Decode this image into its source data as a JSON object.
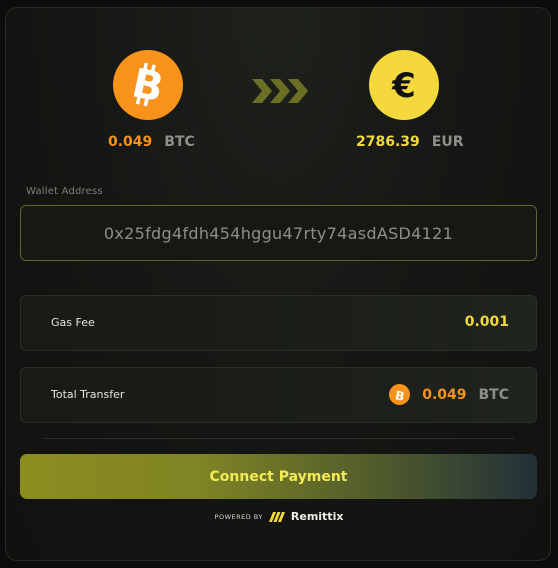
{
  "swap": {
    "from": {
      "amount": "0.049",
      "currency": "BTC",
      "icon": "bitcoin-icon",
      "color": "#f7931a"
    },
    "arrow_icon": "triple-chevron-right-icon",
    "to": {
      "amount": "2786.39",
      "currency": "EUR",
      "icon": "euro-icon",
      "color": "#f5d83c"
    }
  },
  "wallet": {
    "label": "Wallet Address",
    "address": "0x25fdg4fdh454hggu47rty74asdASD4121"
  },
  "gas": {
    "label": "Gas Fee",
    "value": "0.001"
  },
  "total": {
    "label": "Total Transfer",
    "amount": "0.049",
    "currency": "BTC",
    "icon": "bitcoin-icon"
  },
  "action": {
    "connect_label": "Connect Payment"
  },
  "footer": {
    "powered_by": "POWERED BY",
    "brand": "Remittix",
    "logo_icon": "remittix-logo-icon"
  },
  "colors": {
    "accent_yellow": "#f5d83c",
    "btc_orange": "#f7931a",
    "arrow_olive": "#6b6f24"
  }
}
